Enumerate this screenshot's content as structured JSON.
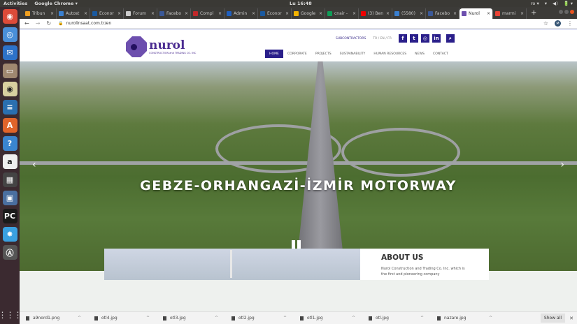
{
  "os": {
    "activities": "Activities",
    "app_menu": "Google Chrome ▾",
    "clock": "Lu 16:48",
    "tray": [
      "ro ▾",
      "▾",
      "◀)",
      "🔋 ▾"
    ]
  },
  "dock": [
    {
      "name": "chrome",
      "color": "#dd4b39",
      "g": "◉"
    },
    {
      "name": "chromium",
      "color": "#4a8fd8",
      "g": "◎"
    },
    {
      "name": "thunderbird",
      "color": "#2d72c8",
      "g": "✉"
    },
    {
      "name": "files",
      "color": "#a08870",
      "g": "▭"
    },
    {
      "name": "rhythmbox",
      "color": "#d8d0a0",
      "g": "◉"
    },
    {
      "name": "writer",
      "color": "#2a6fb0",
      "g": "≡"
    },
    {
      "name": "software",
      "color": "#e0642a",
      "g": "A"
    },
    {
      "name": "help",
      "color": "#3a85d0",
      "g": "?"
    },
    {
      "name": "amazon",
      "color": "#eee",
      "g": "a"
    },
    {
      "name": "calculator",
      "color": "#444",
      "g": "▦"
    },
    {
      "name": "image-viewer",
      "color": "#4a6fa0",
      "g": "▣"
    },
    {
      "name": "pycharm",
      "color": "#1a1a1a",
      "g": "PC"
    },
    {
      "name": "splash",
      "color": "#3aa0e0",
      "g": "✸"
    },
    {
      "name": "updater",
      "color": "#555",
      "g": "Ⓐ"
    }
  ],
  "tabs": [
    {
      "label": "Tribun",
      "color": "#f0a020"
    },
    {
      "label": "Autost",
      "color": "#3a80d0"
    },
    {
      "label": "Econor",
      "color": "#1a5aa0"
    },
    {
      "label": "Forum",
      "color": "#ccc"
    },
    {
      "label": "Facebo",
      "color": "#3b5998"
    },
    {
      "label": "Compl",
      "color": "#c0282a"
    },
    {
      "label": "Admin",
      "color": "#2060c0"
    },
    {
      "label": "Econor",
      "color": "#1a5aa0"
    },
    {
      "label": "Google",
      "color": "#f4b400"
    },
    {
      "label": "cnair -",
      "color": "#0f9d58"
    },
    {
      "label": "(3) Ben",
      "color": "#e00"
    },
    {
      "label": "(5580)",
      "color": "#3a80d0"
    },
    {
      "label": "Facebo",
      "color": "#3b5998"
    },
    {
      "label": "Nurol",
      "color": "#6d4fae",
      "active": true
    },
    {
      "label": "marmi",
      "color": "#ea4335"
    }
  ],
  "address": {
    "url": "nurolinsaat.com.tr/en",
    "avatar": "M"
  },
  "site": {
    "logo_name": "nurol",
    "logo_sub": "CONSTRUCTION and TRADING CO. INC",
    "subcontractors": "SUBCONTRACTORS",
    "langs": "TR / EN / FR",
    "social": [
      "f",
      "t",
      "◎",
      "in",
      "⌕"
    ],
    "menu": [
      "HOME",
      "CORPORATE",
      "PROJECTS",
      "SUSTAINABILITY",
      "HUMAN RESOURCES",
      "NEWS",
      "CONTACT"
    ],
    "hero_title": "GEBZE-ORHANGAZİ-İZMİR MOTORWAY",
    "about_title": "ABOUT US",
    "about_text": "Nurol Construction and Trading Co. Inc. which is the first and pioneering company"
  },
  "downloads": {
    "items": [
      "a9nord1.png",
      "otl4.jpg",
      "otl3.jpg",
      "otl2.jpg",
      "otl1.jpg",
      "otl.jpg",
      "nazare.jpg"
    ],
    "show_all": "Show all"
  }
}
